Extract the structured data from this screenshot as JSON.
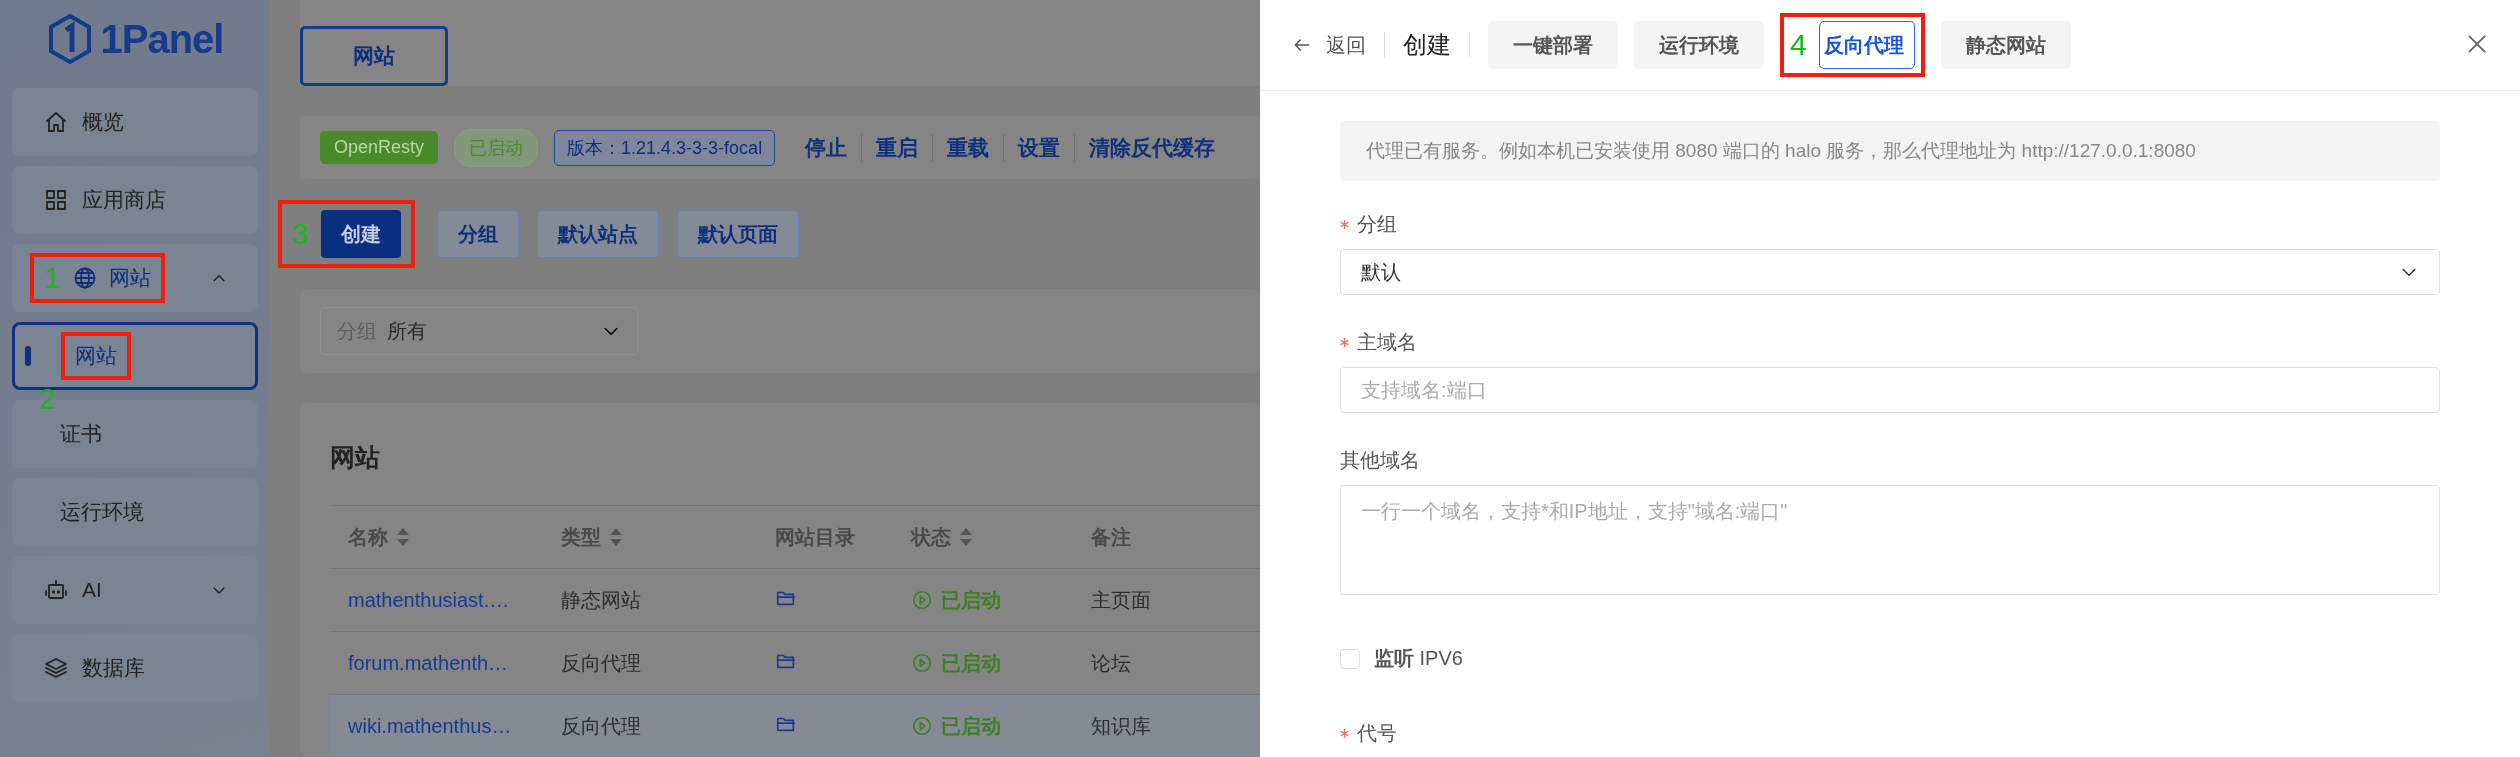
{
  "sidebar": {
    "logo": "1Panel",
    "items": [
      {
        "kind": "link",
        "label": "概览"
      },
      {
        "kind": "link",
        "label": "应用商店"
      },
      {
        "kind": "group",
        "label": "网站",
        "expanded": true,
        "callout": {
          "number": "1"
        },
        "children": [
          {
            "label": "网站",
            "selected": true,
            "callout": {
              "number": "2"
            }
          },
          {
            "label": "证书",
            "selected": false
          },
          {
            "label": "运行环境",
            "selected": false
          }
        ]
      },
      {
        "kind": "group",
        "label": "AI",
        "expanded": false
      },
      {
        "kind": "link",
        "label": "数据库"
      }
    ]
  },
  "page_tab": {
    "label": "网站"
  },
  "status_bar": {
    "app": "OpenResty",
    "state": "已启动",
    "version": "版本：1.21.4.3-3-3-focal",
    "actions": [
      "停止",
      "重启",
      "重载",
      "设置",
      "清除反代缓存"
    ]
  },
  "toolbar": [
    {
      "kind": "primary",
      "label": "创建",
      "callout": {
        "number": "3"
      }
    },
    {
      "kind": "plain",
      "label": "分组"
    },
    {
      "kind": "plain",
      "label": "默认站点"
    },
    {
      "kind": "plain",
      "label": "默认页面"
    }
  ],
  "filter": {
    "label": "分组",
    "value": "所有"
  },
  "table": {
    "title": "网站",
    "columns": [
      {
        "label": "名称",
        "sortable": true
      },
      {
        "label": "类型",
        "sortable": true
      },
      {
        "label": "网站目录",
        "sortable": false
      },
      {
        "label": "状态",
        "sortable": true
      },
      {
        "label": "备注",
        "sortable": false
      }
    ],
    "rows": [
      {
        "name": "mathenthusiast.…",
        "type": "静态网站",
        "status": "已启动",
        "remark": "主页面",
        "hovered": false
      },
      {
        "name": "forum.mathenth…",
        "type": "反向代理",
        "status": "已启动",
        "remark": "论坛",
        "hovered": false
      },
      {
        "name": "wiki.mathenthus…",
        "type": "反向代理",
        "status": "已启动",
        "remark": "知识库",
        "hovered": true
      }
    ]
  },
  "drawer": {
    "back": "返回",
    "title": "创建",
    "tabs": [
      {
        "label": "一键部署",
        "selected": false
      },
      {
        "label": "运行环境",
        "selected": false
      },
      {
        "label": "反向代理",
        "selected": true,
        "callout": {
          "number": "4"
        }
      },
      {
        "label": "静态网站",
        "selected": false
      }
    ],
    "notice": "代理已有服务。例如本机已安装使用 8080 端口的 halo 服务，那么代理地址为 http://127.0.0.1:8080",
    "fields": [
      {
        "kind": "select",
        "label": "分组",
        "required": true,
        "value": "默认"
      },
      {
        "kind": "input",
        "label": "主域名",
        "required": true,
        "placeholder": "支持域名:端口"
      },
      {
        "kind": "textarea",
        "label": "其他域名",
        "required": false,
        "placeholder": "一行一个域名，支持*和IP地址，支持\"域名:端口\""
      },
      {
        "kind": "checkbox",
        "label": "**监听** IPV6",
        "checked": false
      },
      {
        "kind": "label",
        "label": "代号",
        "required": true
      }
    ]
  }
}
